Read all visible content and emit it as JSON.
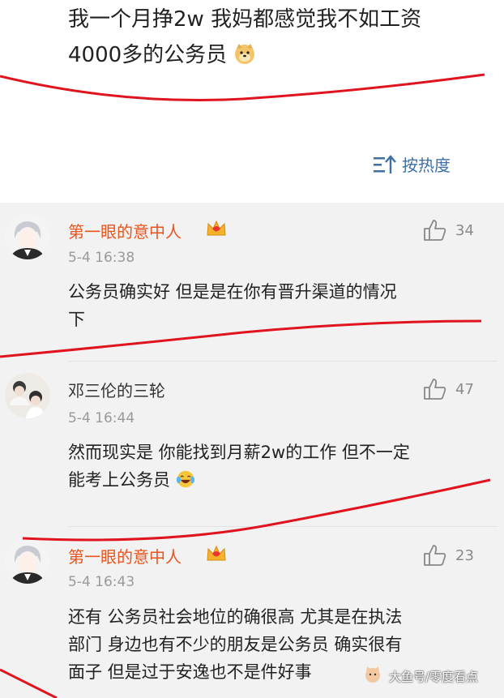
{
  "post": {
    "text_line1": "我一个月挣2w 我妈都感觉我不如工资",
    "text_line2": "4000多的公务员",
    "emoji": "doge-emoji"
  },
  "sort": {
    "label": "按热度",
    "icon": "sort-icon"
  },
  "comments": [
    {
      "username": "第一眼的意中人",
      "username_color": "#e8541e",
      "badge": "crown-badge",
      "time": "5-4 16:38",
      "likes": "34",
      "text_line1": "公务员确实好 但是是在你有晋升渠道的情况",
      "text_line2": "下"
    },
    {
      "username": "邓三伦的三轮",
      "username_color": "#333333",
      "time": "5-4 16:44",
      "likes": "47",
      "text_line1": "然而现实是 你能找到月薪2w的工作 但不一定",
      "text_line2": "能考上公务员",
      "emoji": "laugh-cry-emoji"
    },
    {
      "username": "第一眼的意中人",
      "username_color": "#e8541e",
      "badge": "crown-badge",
      "time": "5-4 16:43",
      "likes": "23",
      "text_line1": "还有 公务员社会地位的确很高 尤其是在执法",
      "text_line2": "部门 身边也有不少的朋友是公务员 确实很有",
      "text_line3": "面子 但是过于安逸也不是件好事"
    }
  ],
  "watermark": "大鱼号/零度看点",
  "colors": {
    "accent_link": "#3f6fa5",
    "annotation": "#e0141e",
    "vip_name": "#e8541e"
  }
}
